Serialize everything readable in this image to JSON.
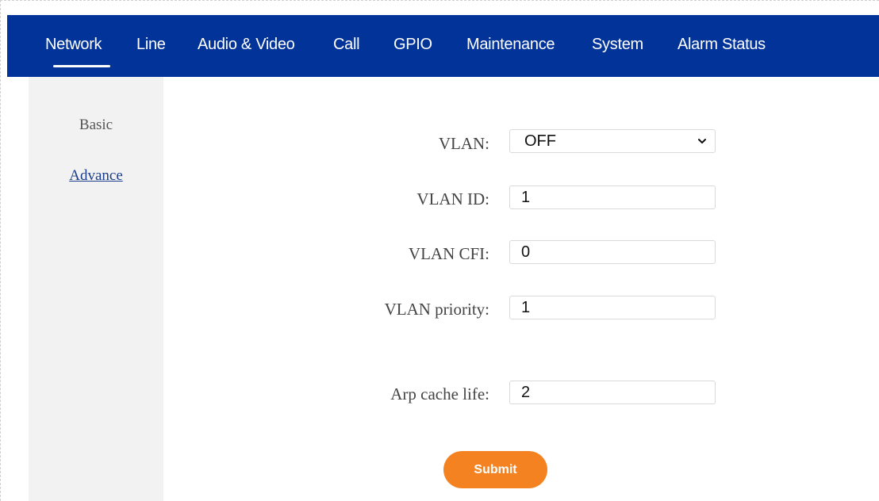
{
  "nav": {
    "items": [
      "Network",
      "Line",
      "Audio & Video",
      "Call",
      "GPIO",
      "Maintenance",
      "System",
      "Alarm Status"
    ],
    "active": "Network"
  },
  "sidebar": {
    "items": [
      "Basic",
      "Advance"
    ],
    "active": "Advance"
  },
  "form": {
    "vlan": {
      "label": "VLAN:",
      "value": "OFF"
    },
    "vlan_id": {
      "label": "VLAN ID:",
      "value": "1"
    },
    "vlan_cfi": {
      "label": "VLAN CFI:",
      "value": "0"
    },
    "vlan_priority": {
      "label": "VLAN priority:",
      "value": "1"
    },
    "arp_cache_life": {
      "label": "Arp cache life:",
      "value": "2"
    },
    "submit_label": "Submit"
  },
  "colors": {
    "navbar": "#013399",
    "accent": "#f58220",
    "sidebar": "#f2f2f2"
  },
  "icons": {
    "select_caret": "chevron-down-icon"
  }
}
